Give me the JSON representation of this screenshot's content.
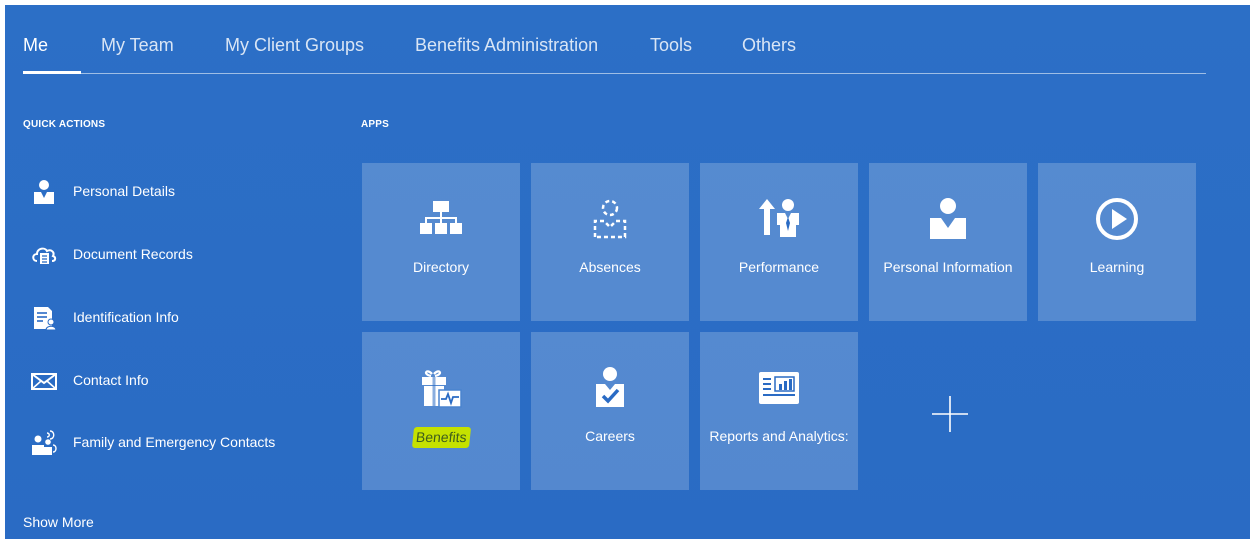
{
  "nav": {
    "tabs": [
      {
        "label": "Me",
        "active": true
      },
      {
        "label": "My Team"
      },
      {
        "label": "My Client Groups"
      },
      {
        "label": "Benefits Administration"
      },
      {
        "label": "Tools"
      },
      {
        "label": "Others"
      }
    ]
  },
  "quick_actions": {
    "title": "QUICK ACTIONS",
    "items": [
      {
        "label": "Personal Details",
        "icon": "person-icon"
      },
      {
        "label": "Document Records",
        "icon": "cloud-document-icon"
      },
      {
        "label": "Identification Info",
        "icon": "id-document-icon"
      },
      {
        "label": "Contact Info",
        "icon": "envelope-icon"
      },
      {
        "label": "Family and Emergency Contacts",
        "icon": "family-icon"
      }
    ],
    "show_more": "Show More"
  },
  "apps": {
    "title": "APPS",
    "tiles": [
      {
        "label": "Directory",
        "icon": "org-chart-icon"
      },
      {
        "label": "Absences",
        "icon": "dashed-person-icon"
      },
      {
        "label": "Performance",
        "icon": "arrow-person-icon"
      },
      {
        "label": "Personal Information",
        "icon": "person-icon"
      },
      {
        "label": "Learning",
        "icon": "play-circle-icon"
      },
      {
        "label": "Benefits",
        "icon": "gift-heartbeat-icon",
        "highlighted": true
      },
      {
        "label": "Careers",
        "icon": "person-check-icon"
      },
      {
        "label": "Reports and Analytics:",
        "icon": "report-chart-icon"
      }
    ],
    "add_tile_icon": "plus-icon"
  },
  "colors": {
    "background": "#2a6bc4",
    "tile": "rgba(255,255,255,0.2)",
    "highlight": "#c5e100"
  }
}
